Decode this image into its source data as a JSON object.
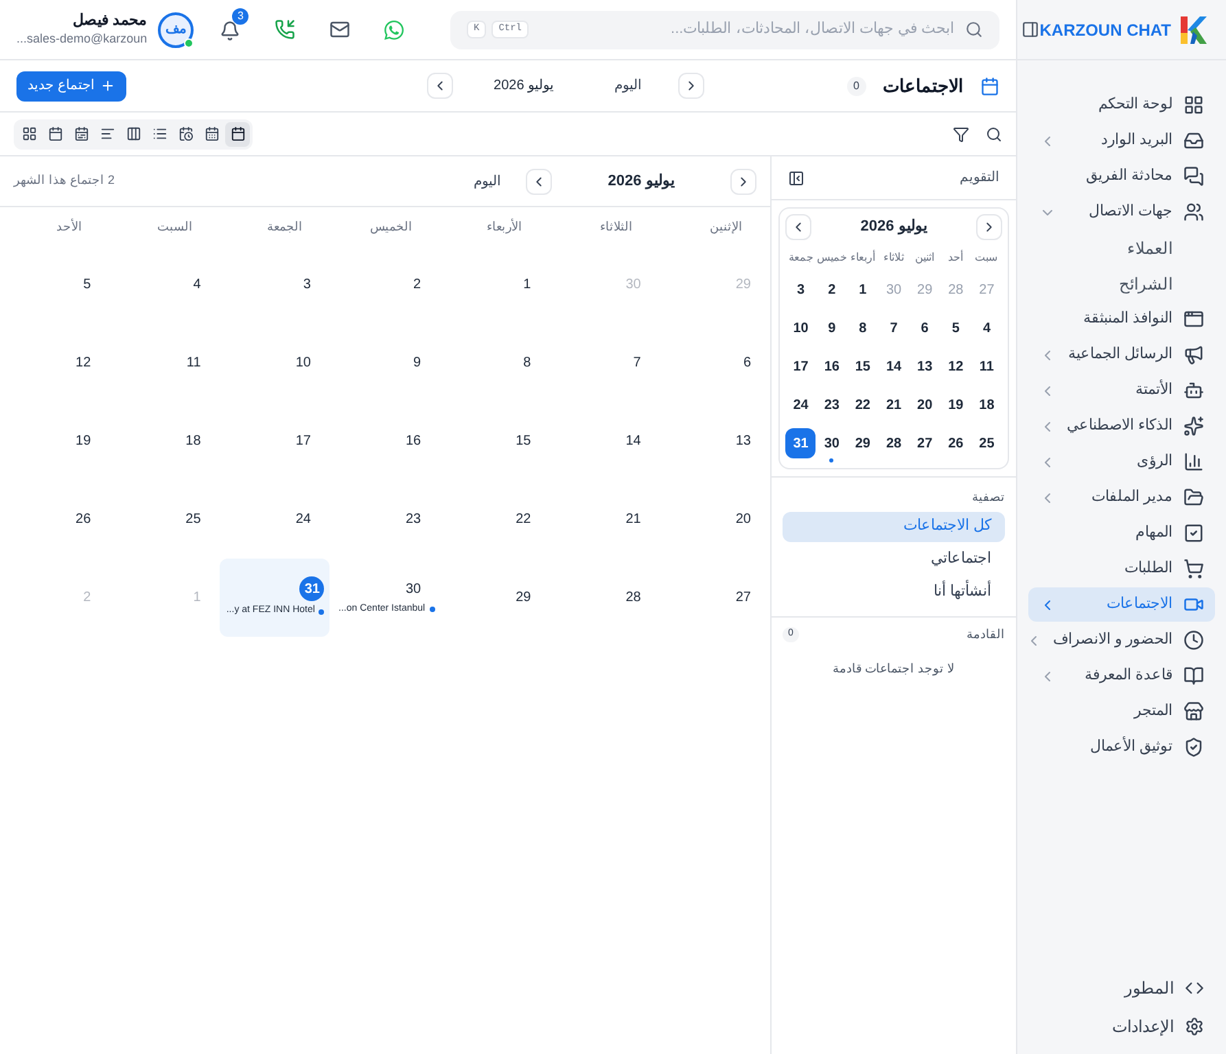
{
  "sidebar": {
    "brand": "KARZOUN CHAT",
    "items": [
      {
        "label": "لوحة التحكم",
        "kind": "link",
        "selected": false
      },
      {
        "label": "البريد الوارد",
        "kind": "group",
        "expanded": false,
        "selected": false
      },
      {
        "label": "محادثة الفريق",
        "kind": "link",
        "selected": false
      },
      {
        "label": "جهات الاتصال",
        "kind": "group",
        "expanded": true,
        "selected": false,
        "children": [
          {
            "label": "العملاء",
            "selected": false
          },
          {
            "label": "الشرائح",
            "selected": false
          }
        ]
      },
      {
        "label": "النوافذ المنبثقة",
        "kind": "link",
        "selected": false
      },
      {
        "label": "الرسائل الجماعية",
        "kind": "group",
        "expanded": false,
        "selected": false
      },
      {
        "label": "الأتمتة",
        "kind": "group",
        "expanded": false,
        "selected": false
      },
      {
        "label": "الذكاء الاصطناعي",
        "kind": "group",
        "expanded": false,
        "selected": false
      },
      {
        "label": "الرؤى",
        "kind": "group",
        "expanded": false,
        "selected": false
      },
      {
        "label": "مدير الملفات",
        "kind": "group",
        "expanded": false,
        "selected": false
      },
      {
        "label": "المهام",
        "kind": "link",
        "selected": false
      },
      {
        "label": "الطلبات",
        "kind": "link",
        "selected": false
      },
      {
        "label": "الاجتماعات",
        "kind": "group",
        "expanded": false,
        "selected": true
      },
      {
        "label": "الحضور و الانصراف",
        "kind": "group",
        "expanded": false,
        "selected": false
      },
      {
        "label": "قاعدة المعرفة",
        "kind": "group",
        "expanded": false,
        "selected": false
      },
      {
        "label": "المتجر",
        "kind": "link",
        "selected": false
      },
      {
        "label": "توثيق الأعمال",
        "kind": "link",
        "selected": false
      }
    ],
    "bottom": [
      {
        "label": "المطور"
      },
      {
        "label": "الإعدادات"
      }
    ]
  },
  "header": {
    "search": {
      "placeholder": "ابحث في جهات الاتصال، المحادثات، الطلبات...",
      "shortcut": [
        "Ctrl",
        "K"
      ]
    },
    "notifications": "3",
    "user": {
      "initials": "مف",
      "name": "محمد فيصل",
      "email": "sales-demo@karzoun...",
      "online": true
    }
  },
  "page": {
    "title": "الاجتماعات",
    "count": "0",
    "today": "اليوم",
    "month": "يوليو 2026",
    "new_button": "اجتماع جديد"
  },
  "toolbar": {
    "views": [
      {
        "selected": true
      },
      {
        "selected": false
      },
      {
        "selected": false
      },
      {
        "selected": false
      },
      {
        "selected": false
      },
      {
        "selected": false
      },
      {
        "selected": false
      },
      {
        "selected": false
      },
      {
        "selected": false
      }
    ]
  },
  "side_panel": {
    "title": "التقويم",
    "month": "يوليو 2026",
    "weekdays": [
      "سبت",
      "أحد",
      "اثنين",
      "ثلاثاء",
      "أربعاء",
      "خميس",
      "جمعة"
    ],
    "weeks": [
      [
        {
          "day": "27",
          "muted": true,
          "selected": false,
          "has_event": false
        },
        {
          "day": "28",
          "muted": true,
          "selected": false,
          "has_event": false
        },
        {
          "day": "29",
          "muted": true,
          "selected": false,
          "has_event": false
        },
        {
          "day": "30",
          "muted": true,
          "selected": false,
          "has_event": false
        },
        {
          "day": "1",
          "muted": false,
          "selected": false,
          "has_event": false
        },
        {
          "day": "2",
          "muted": false,
          "selected": false,
          "has_event": false
        },
        {
          "day": "3",
          "muted": false,
          "selected": false,
          "has_event": false
        }
      ],
      [
        {
          "day": "4",
          "muted": false,
          "selected": false,
          "has_event": false
        },
        {
          "day": "5",
          "muted": false,
          "selected": false,
          "has_event": false
        },
        {
          "day": "6",
          "muted": false,
          "selected": false,
          "has_event": false
        },
        {
          "day": "7",
          "muted": false,
          "selected": false,
          "has_event": false
        },
        {
          "day": "8",
          "muted": false,
          "selected": false,
          "has_event": false
        },
        {
          "day": "9",
          "muted": false,
          "selected": false,
          "has_event": false
        },
        {
          "day": "10",
          "muted": false,
          "selected": false,
          "has_event": false
        }
      ],
      [
        {
          "day": "11",
          "muted": false,
          "selected": false,
          "has_event": false
        },
        {
          "day": "12",
          "muted": false,
          "selected": false,
          "has_event": false
        },
        {
          "day": "13",
          "muted": false,
          "selected": false,
          "has_event": false
        },
        {
          "day": "14",
          "muted": false,
          "selected": false,
          "has_event": false
        },
        {
          "day": "15",
          "muted": false,
          "selected": false,
          "has_event": false
        },
        {
          "day": "16",
          "muted": false,
          "selected": false,
          "has_event": false
        },
        {
          "day": "17",
          "muted": false,
          "selected": false,
          "has_event": false
        }
      ],
      [
        {
          "day": "18",
          "muted": false,
          "selected": false,
          "has_event": false
        },
        {
          "day": "19",
          "muted": false,
          "selected": false,
          "has_event": false
        },
        {
          "day": "20",
          "muted": false,
          "selected": false,
          "has_event": false
        },
        {
          "day": "21",
          "muted": false,
          "selected": false,
          "has_event": false
        },
        {
          "day": "22",
          "muted": false,
          "selected": false,
          "has_event": false
        },
        {
          "day": "23",
          "muted": false,
          "selected": false,
          "has_event": false
        },
        {
          "day": "24",
          "muted": false,
          "selected": false,
          "has_event": false
        }
      ],
      [
        {
          "day": "25",
          "muted": false,
          "selected": false,
          "has_event": false
        },
        {
          "day": "26",
          "muted": false,
          "selected": false,
          "has_event": false
        },
        {
          "day": "27",
          "muted": false,
          "selected": false,
          "has_event": false
        },
        {
          "day": "28",
          "muted": false,
          "selected": false,
          "has_event": false
        },
        {
          "day": "29",
          "muted": false,
          "selected": false,
          "has_event": false
        },
        {
          "day": "30",
          "muted": false,
          "selected": false,
          "has_event": true
        },
        {
          "day": "31",
          "muted": false,
          "selected": true,
          "has_event": false
        }
      ]
    ],
    "filter": {
      "title": "تصفية",
      "options": [
        {
          "label": "كل الاجتماعات",
          "selected": true
        },
        {
          "label": "اجتماعاتي",
          "selected": false
        },
        {
          "label": "أنشأتها أنا",
          "selected": false
        }
      ]
    },
    "upcoming": {
      "title": "القادمة",
      "count": "0",
      "empty": "لا توجد اجتماعات قادمة"
    }
  },
  "calendar": {
    "month": "يوليو 2026",
    "today": "اليوم",
    "summary": "2 اجتماع هذا الشهر",
    "weekdays": [
      "الإثنين",
      "الثلاثاء",
      "الأربعاء",
      "الخميس",
      "الجمعة",
      "السبت",
      "الأحد"
    ],
    "weeks": [
      [
        {
          "day": "29",
          "muted": true,
          "selected": false
        },
        {
          "day": "30",
          "muted": true,
          "selected": false
        },
        {
          "day": "1",
          "muted": false,
          "selected": false
        },
        {
          "day": "2",
          "muted": false,
          "selected": false
        },
        {
          "day": "3",
          "muted": false,
          "selected": false
        },
        {
          "day": "4",
          "muted": false,
          "selected": false
        },
        {
          "day": "5",
          "muted": false,
          "selected": false
        }
      ],
      [
        {
          "day": "6",
          "muted": false,
          "selected": false
        },
        {
          "day": "7",
          "muted": false,
          "selected": false
        },
        {
          "day": "8",
          "muted": false,
          "selected": false
        },
        {
          "day": "9",
          "muted": false,
          "selected": false
        },
        {
          "day": "10",
          "muted": false,
          "selected": false
        },
        {
          "day": "11",
          "muted": false,
          "selected": false
        },
        {
          "day": "12",
          "muted": false,
          "selected": false
        }
      ],
      [
        {
          "day": "13",
          "muted": false,
          "selected": false
        },
        {
          "day": "14",
          "muted": false,
          "selected": false
        },
        {
          "day": "15",
          "muted": false,
          "selected": false
        },
        {
          "day": "16",
          "muted": false,
          "selected": false
        },
        {
          "day": "17",
          "muted": false,
          "selected": false
        },
        {
          "day": "18",
          "muted": false,
          "selected": false
        },
        {
          "day": "19",
          "muted": false,
          "selected": false
        }
      ],
      [
        {
          "day": "20",
          "muted": false,
          "selected": false
        },
        {
          "day": "21",
          "muted": false,
          "selected": false
        },
        {
          "day": "22",
          "muted": false,
          "selected": false
        },
        {
          "day": "23",
          "muted": false,
          "selected": false
        },
        {
          "day": "24",
          "muted": false,
          "selected": false
        },
        {
          "day": "25",
          "muted": false,
          "selected": false
        },
        {
          "day": "26",
          "muted": false,
          "selected": false
        }
      ],
      [
        {
          "day": "27",
          "muted": false,
          "selected": false
        },
        {
          "day": "28",
          "muted": false,
          "selected": false
        },
        {
          "day": "29",
          "muted": false,
          "selected": false
        },
        {
          "day": "30",
          "muted": false,
          "selected": false,
          "events": [
            {
              "title": "...on Center Istanbul"
            }
          ]
        },
        {
          "day": "31",
          "muted": false,
          "selected": true,
          "events": [
            {
              "title": "...y at FEZ INN Hotel"
            }
          ]
        },
        {
          "day": "1",
          "muted": true,
          "selected": false
        },
        {
          "day": "2",
          "muted": true,
          "selected": false
        }
      ]
    ]
  }
}
